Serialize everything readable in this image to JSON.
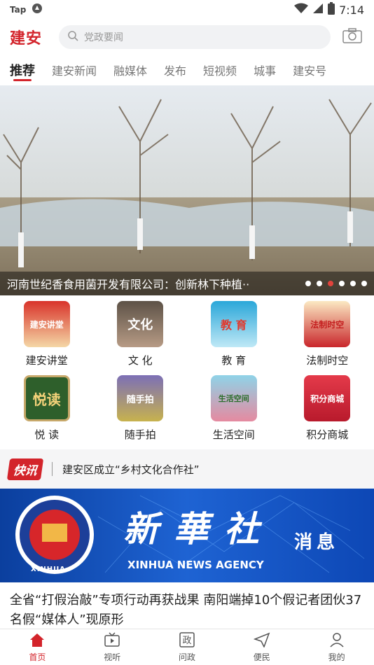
{
  "status": {
    "carrier": "Tap",
    "time": "7:14"
  },
  "header": {
    "logo": "建安",
    "search_placeholder": "党政要闻"
  },
  "tabs": [
    {
      "label": "推荐"
    },
    {
      "label": "建安新闻"
    },
    {
      "label": "融媒体"
    },
    {
      "label": "发布"
    },
    {
      "label": "短视频"
    },
    {
      "label": "城事"
    },
    {
      "label": "建安号"
    }
  ],
  "hero": {
    "caption": "河南世纪香食用菌开发有限公司：创新林下种植··"
  },
  "grid": [
    {
      "label": "建安讲堂",
      "tile_text": "建安讲堂",
      "color": "#c8261d"
    },
    {
      "label": "文 化",
      "tile_text": "文化",
      "color": "#7a6a5a"
    },
    {
      "label": "教 育",
      "tile_text": "教 育",
      "color": "#2aa7d9"
    },
    {
      "label": "法制时空",
      "tile_text": "法制时空",
      "color": "#d7b24b"
    },
    {
      "label": "悦 读",
      "tile_text": "悦读",
      "color": "#2e5f2b"
    },
    {
      "label": "随手拍",
      "tile_text": "随手拍",
      "color": "#5a4b8a"
    },
    {
      "label": "生活空间",
      "tile_text": "生活空间",
      "color": "#8fd3e8"
    },
    {
      "label": "积分商城",
      "tile_text": "积分商城",
      "color": "#d9273a"
    }
  ],
  "flash": {
    "badge": "快讯",
    "text": "建安区成立“乡村文化合作社”"
  },
  "banner": {
    "title": "新華社",
    "subtitle": "消息",
    "english": "XINHUA NEWS AGENCY",
    "emblem": "XINHUA"
  },
  "news": {
    "headline": "全省“打假治敲”专项行动再获战果 南阳端掉10个假记者团伙37名假“媒体人”现原形"
  },
  "tabbar": [
    {
      "label": "首页"
    },
    {
      "label": "视听"
    },
    {
      "label": "问政"
    },
    {
      "label": "便民"
    },
    {
      "label": "我的"
    }
  ]
}
